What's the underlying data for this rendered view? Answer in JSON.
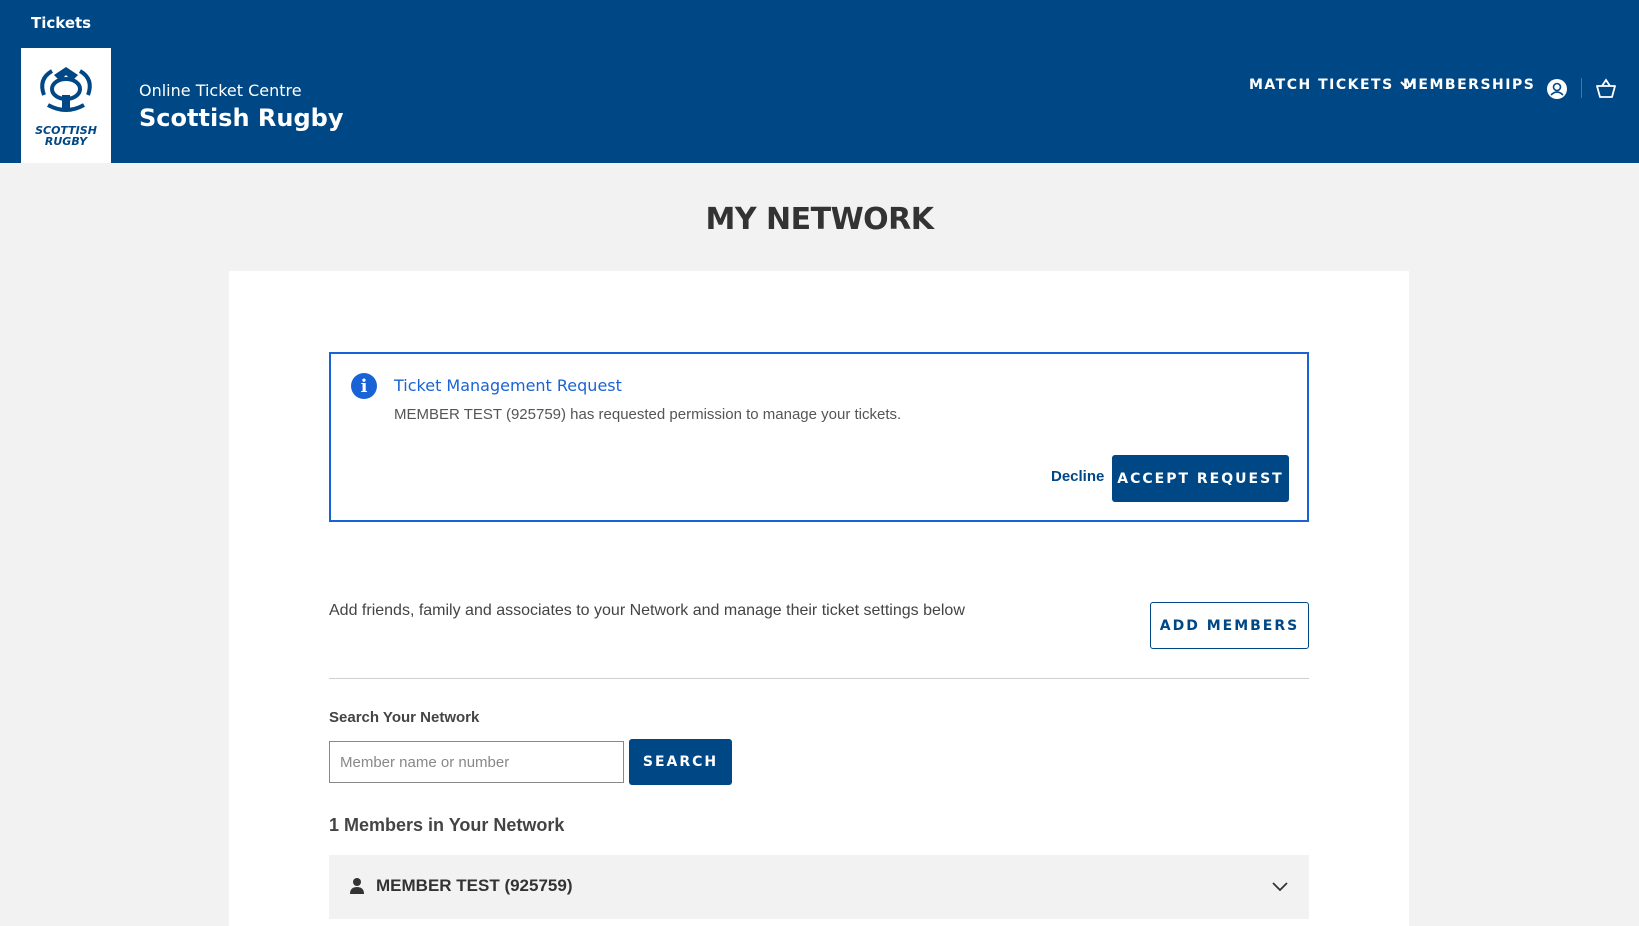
{
  "header": {
    "top_link": "Tickets",
    "logo_text_line1": "SCOTTISH",
    "logo_text_line2": "RUGBY",
    "subtitle": "Online Ticket Centre",
    "title": "Scottish Rugby",
    "nav": {
      "match_tickets": "MATCH TICKETS",
      "memberships": "MEMBERSHIPS"
    },
    "icons": [
      "user-icon",
      "basket-icon",
      "chevron-down-icon"
    ]
  },
  "page": {
    "title": "MY NETWORK"
  },
  "alert": {
    "title": "Ticket Management Request",
    "message": "MEMBER TEST (925759) has requested permission to manage your tickets.",
    "decline_label": "Decline",
    "accept_label": "ACCEPT REQUEST"
  },
  "network": {
    "intro": "Add friends, family and associates to your Network and manage their ticket settings below",
    "add_members_label": "ADD MEMBERS",
    "search_label": "Search Your Network",
    "search_placeholder": "Member name or number",
    "search_value": "",
    "search_button": "SEARCH",
    "count_label": "1 Members in Your Network",
    "members": [
      {
        "name": "MEMBER TEST (925759)"
      }
    ]
  },
  "colors": {
    "brand": "#004785",
    "alert_accent": "#1a63d6",
    "page_bg": "#f2f2f2"
  }
}
